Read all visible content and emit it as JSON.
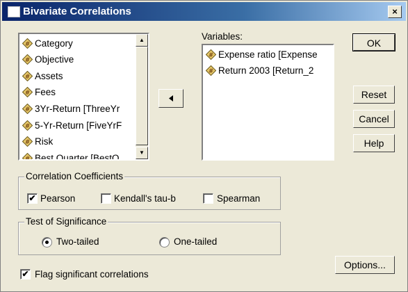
{
  "window": {
    "title": "Bivariate Correlations",
    "close_label": "×"
  },
  "source_list": {
    "items": [
      {
        "label": "Category"
      },
      {
        "label": "Objective"
      },
      {
        "label": "Assets"
      },
      {
        "label": "Fees"
      },
      {
        "label": "3Yr-Return [ThreeYr"
      },
      {
        "label": "5-Yr-Return [FiveYrF"
      },
      {
        "label": "Risk"
      },
      {
        "label": "Best Quarter [BestQ"
      }
    ]
  },
  "variables": {
    "label": "Variables:",
    "items": [
      {
        "label": "Expense ratio [Expense"
      },
      {
        "label": "Return 2003 [Return_2"
      }
    ]
  },
  "buttons": {
    "ok": "OK",
    "reset": "Reset",
    "cancel": "Cancel",
    "help": "Help",
    "options": "Options..."
  },
  "correlation": {
    "legend": "Correlation Coefficients",
    "pearson": {
      "label": "Pearson",
      "checked": true
    },
    "kendall": {
      "label": "Kendall's tau-b",
      "checked": false
    },
    "spearman": {
      "label": "Spearman",
      "checked": false
    }
  },
  "significance": {
    "legend": "Test of Significance",
    "two_tailed": {
      "label": "Two-tailed",
      "selected": true
    },
    "one_tailed": {
      "label": "One-tailed",
      "selected": false
    }
  },
  "flag": {
    "label": "Flag significant correlations",
    "checked": true
  },
  "check_mark": "✔"
}
